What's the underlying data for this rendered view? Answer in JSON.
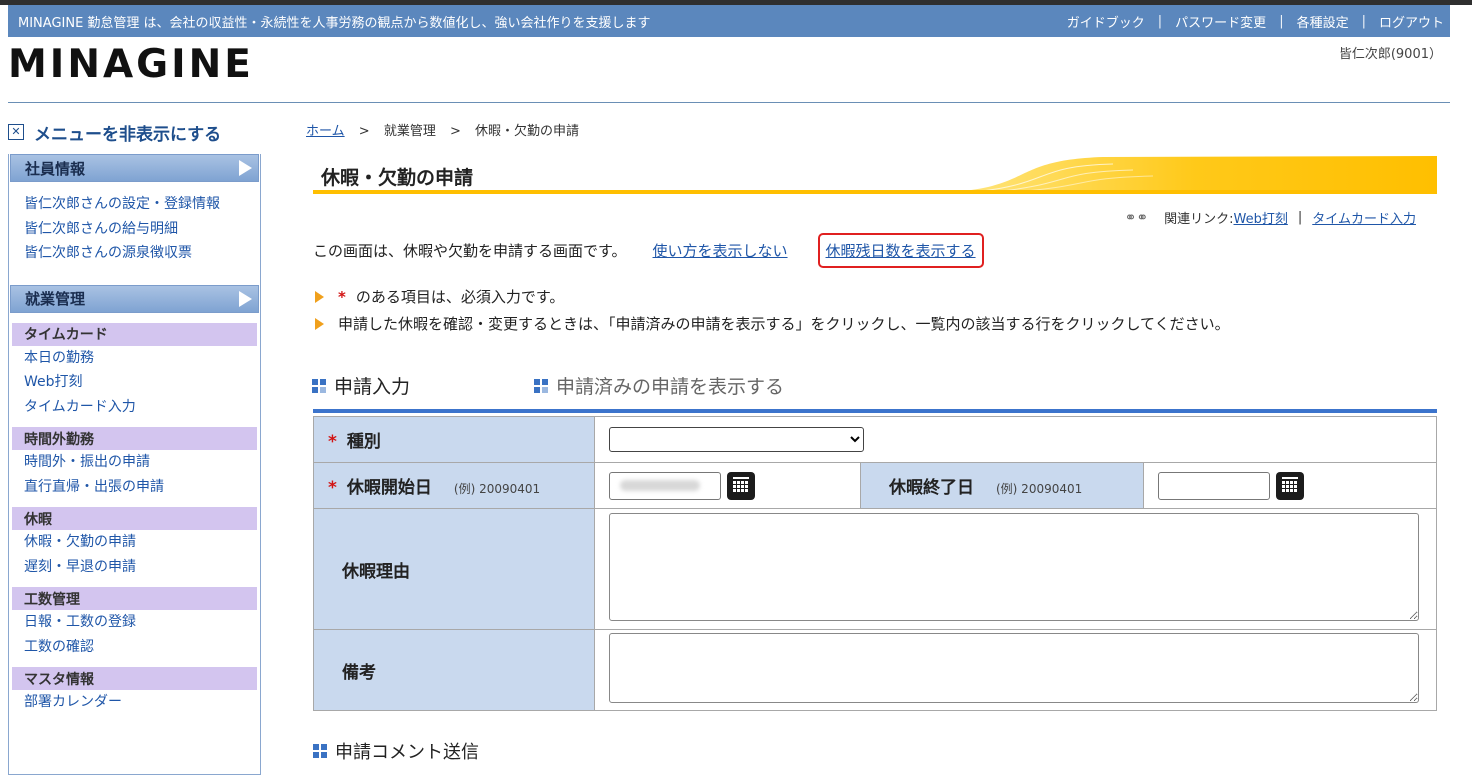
{
  "header": {
    "tagline": "MINAGINE 勤怠管理 は、会社の収益性・永続性を人事労務の観点から数値化し、強い会社作りを支援します",
    "links": [
      "ガイドブック",
      "パスワード変更",
      "各種設定",
      "ログアウト"
    ],
    "logo": "MINAGINE",
    "user": "皆仁次郎(9001）"
  },
  "sidebar": {
    "hide_menu": "メニューを非表示にする",
    "employee_info": {
      "title": "社員情報",
      "items": [
        "皆仁次郎さんの設定・登録情報",
        "皆仁次郎さんの給与明細",
        "皆仁次郎さんの源泉徴収票"
      ]
    },
    "work_mgmt": {
      "title": "就業管理",
      "groups": [
        {
          "title": "タイムカード",
          "items": [
            "本日の勤務",
            "Web打刻",
            "タイムカード入力"
          ]
        },
        {
          "title": "時間外勤務",
          "items": [
            "時間外・振出の申請",
            "直行直帰・出張の申請"
          ]
        },
        {
          "title": "休暇",
          "items": [
            "休暇・欠勤の申請",
            "遅刻・早退の申請"
          ]
        },
        {
          "title": "工数管理",
          "items": [
            "日報・工数の登録",
            "工数の確認"
          ]
        },
        {
          "title": "マスタ情報",
          "items": [
            "部署カレンダー"
          ]
        }
      ]
    }
  },
  "breadcrumb": {
    "home": "ホーム",
    "gt": ">",
    "level2": "就業管理",
    "current": "休暇・欠勤の申請"
  },
  "page_title": "休暇・欠勤の申請",
  "related": {
    "label": "関連リンク:",
    "links": [
      "Web打刻",
      "タイムカード入力"
    ],
    "sep": "|"
  },
  "intro": {
    "text": "この画面は、休暇や欠勤を申請する画面です。",
    "hide_usage": "使い方を表示しない",
    "show_remaining": "休暇残日数を表示する"
  },
  "notes": {
    "required": "のある項目は、必須入力です。",
    "edit_hint": "申請した休暇を確認・変更するときは、「申請済みの申請を表示する」をクリックし、一覧内の該当する行をクリックしてください。"
  },
  "tabs": {
    "input": "申請入力",
    "submitted": "申請済みの申請を表示する"
  },
  "form": {
    "required_mark": "*",
    "kind_label": "種別",
    "kind_value": "",
    "start_label": "休暇開始日",
    "start_example": "(例) 20090401",
    "end_label": "休暇終了日",
    "end_example": "(例) 20090401",
    "end_value": "",
    "reason_label": "休暇理由",
    "remarks_label": "備考"
  },
  "next_section": "申請コメント送信"
}
